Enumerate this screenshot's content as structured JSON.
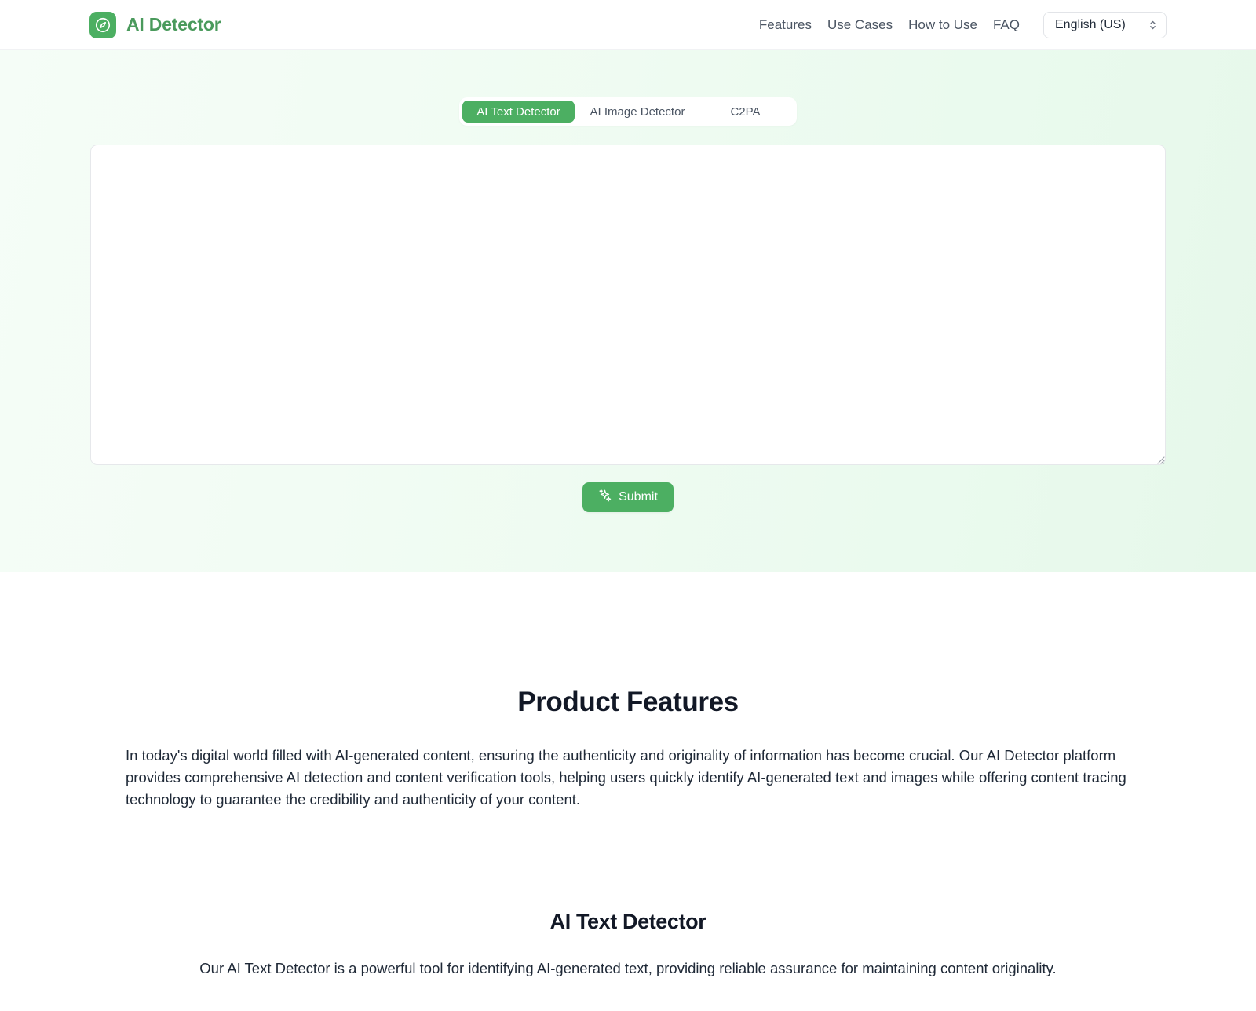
{
  "header": {
    "brand": {
      "name": "AI Detector",
      "icon": "compass-icon"
    },
    "nav": [
      {
        "label": "Features"
      },
      {
        "label": "Use Cases"
      },
      {
        "label": "How to Use"
      },
      {
        "label": "FAQ"
      }
    ],
    "language": {
      "selected": "English (US)",
      "options": [
        "English (US)"
      ]
    }
  },
  "hero": {
    "tabs": [
      {
        "label": "AI Text Detector",
        "active": true
      },
      {
        "label": "AI Image Detector",
        "active": false
      },
      {
        "label": "C2PA",
        "active": false
      }
    ],
    "textarea": {
      "value": "",
      "placeholder": ""
    },
    "submit": {
      "label": "Submit",
      "icon": "sparkles-icon"
    }
  },
  "sections": [
    {
      "title": "Product Features",
      "body": "In today's digital world filled with AI-generated content, ensuring the authenticity and originality of information has become crucial. Our AI Detector platform provides comprehensive AI detection and content verification tools, helping users quickly identify AI-generated text and images while offering content tracing technology to guarantee the credibility and authenticity of your content."
    },
    {
      "title": "AI Text Detector",
      "body": "Our AI Text Detector is a powerful tool for identifying AI-generated text, providing reliable assurance for maintaining content originality."
    }
  ],
  "colors": {
    "brand_green": "#4caf62",
    "brand_text_green": "#4a9a5c",
    "hero_bg_start": "#f5fdf7",
    "hero_bg_end": "#e6f8ea",
    "heading": "#121826"
  }
}
